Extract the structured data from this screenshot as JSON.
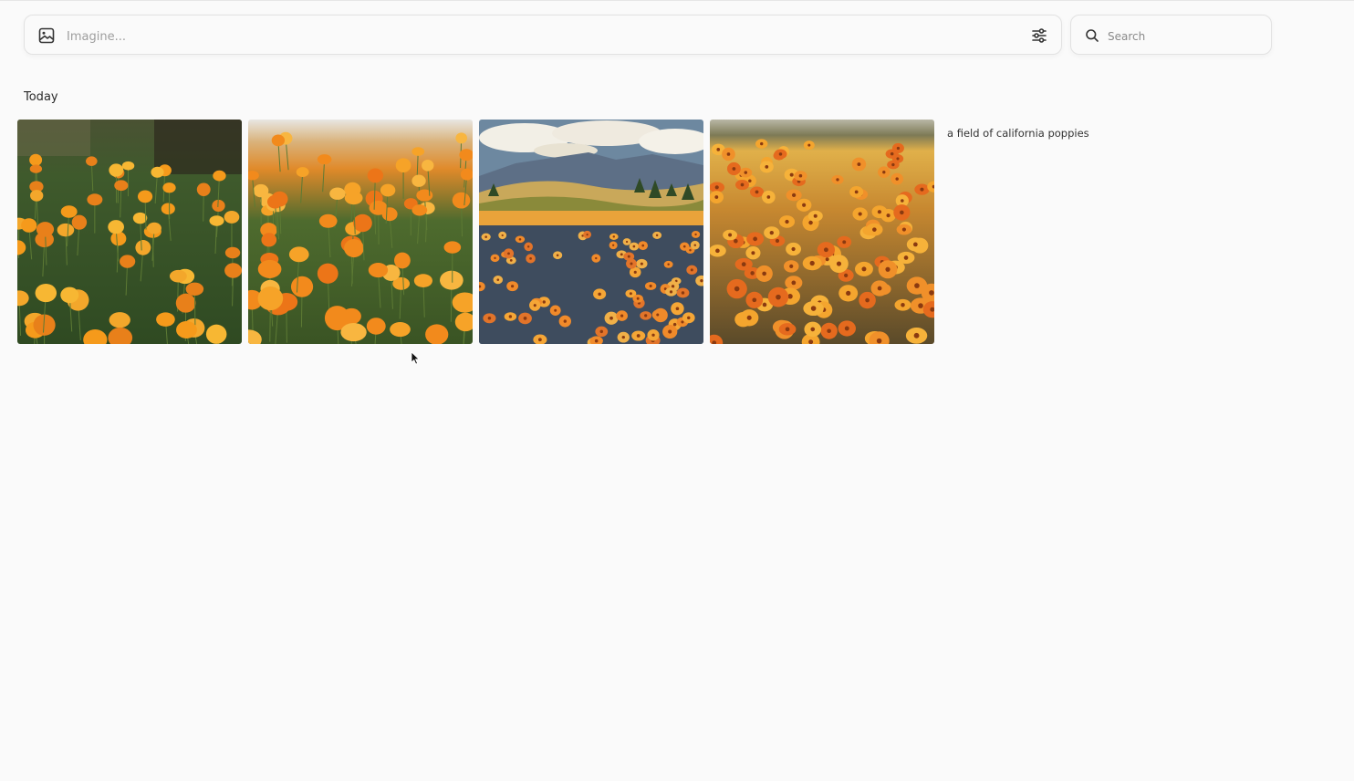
{
  "prompt_bar": {
    "placeholder": "Imagine...",
    "icon": "image-icon",
    "settings_icon": "sliders-icon"
  },
  "search": {
    "placeholder": "Search",
    "icon": "search-icon"
  },
  "section": {
    "title": "Today"
  },
  "generation": {
    "prompt": "a field of california poppies",
    "images": [
      {
        "style": "photo-closeup"
      },
      {
        "style": "photo-hillside"
      },
      {
        "style": "painting-landscape"
      },
      {
        "style": "painting-dense"
      }
    ]
  },
  "colors": {
    "background": "#fafafa",
    "border": "#e2e2e2",
    "poppy": "#f28c1a"
  }
}
